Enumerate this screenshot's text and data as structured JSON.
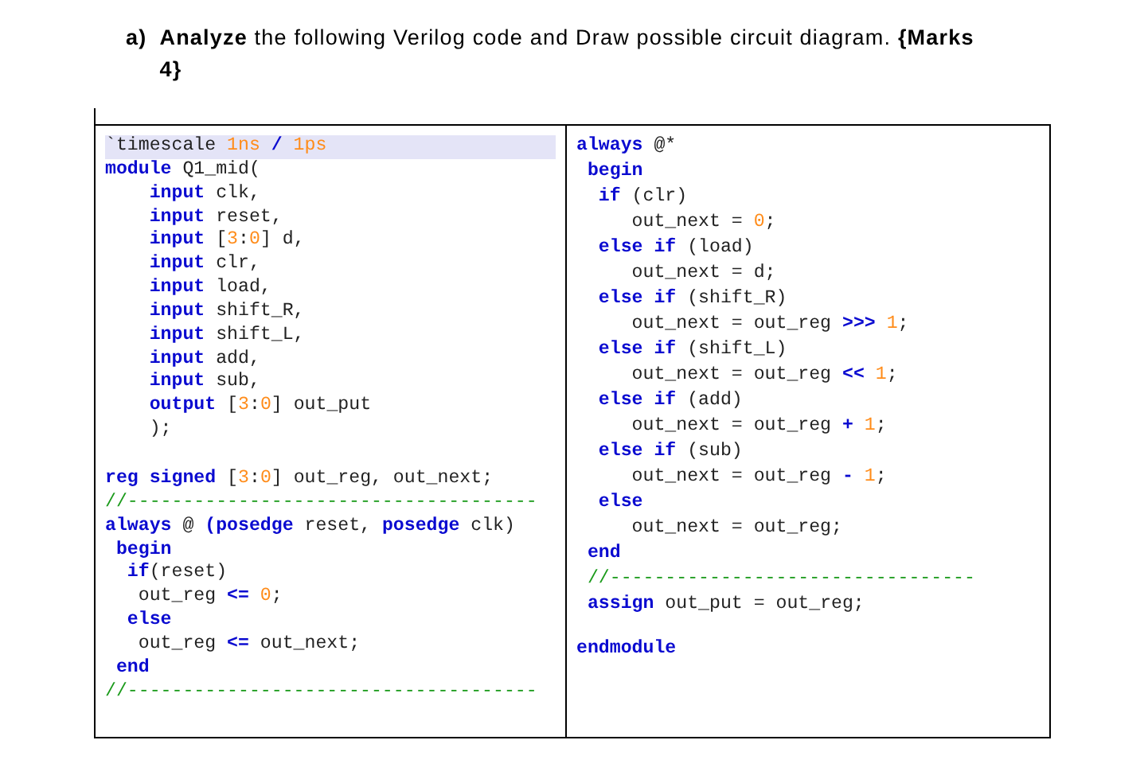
{
  "question": {
    "label": "a)",
    "text": "**Analyze** the following Verilog code and Draw possible circuit diagram. **{Marks 4}**"
  },
  "code_columns": [
    {
      "lines": [
        {
          "kind": "code",
          "highlighted": true,
          "tokens": [
            {
              "kind": "plain",
              "text": "`timescale "
            },
            {
              "kind": "num",
              "text": "1ns"
            },
            {
              "kind": "kw",
              "text": " / "
            },
            {
              "kind": "num",
              "text": "1ps"
            }
          ]
        },
        {
          "kind": "code",
          "highlighted": false,
          "tokens": [
            {
              "kind": "kw",
              "text": "module"
            },
            {
              "kind": "plain",
              "text": " Q1_mid("
            }
          ]
        },
        {
          "kind": "code",
          "highlighted": false,
          "tokens": [
            {
              "kind": "kw",
              "text": "    input"
            },
            {
              "kind": "plain",
              "text": " clk,"
            }
          ]
        },
        {
          "kind": "code",
          "highlighted": false,
          "tokens": [
            {
              "kind": "kw",
              "text": "    input"
            },
            {
              "kind": "plain",
              "text": " reset,"
            }
          ]
        },
        {
          "kind": "code",
          "highlighted": false,
          "tokens": [
            {
              "kind": "kw",
              "text": "    input"
            },
            {
              "kind": "plain",
              "text": " ["
            },
            {
              "kind": "num",
              "text": "3"
            },
            {
              "kind": "plain",
              "text": ":"
            },
            {
              "kind": "num",
              "text": "0"
            },
            {
              "kind": "plain",
              "text": "] d,"
            }
          ]
        },
        {
          "kind": "code",
          "highlighted": false,
          "tokens": [
            {
              "kind": "kw",
              "text": "    input"
            },
            {
              "kind": "plain",
              "text": " clr,"
            }
          ]
        },
        {
          "kind": "code",
          "highlighted": false,
          "tokens": [
            {
              "kind": "kw",
              "text": "    input"
            },
            {
              "kind": "plain",
              "text": " load,"
            }
          ]
        },
        {
          "kind": "code",
          "highlighted": false,
          "tokens": [
            {
              "kind": "kw",
              "text": "    input"
            },
            {
              "kind": "plain",
              "text": " shift_R,"
            }
          ]
        },
        {
          "kind": "code",
          "highlighted": false,
          "tokens": [
            {
              "kind": "kw",
              "text": "    input"
            },
            {
              "kind": "plain",
              "text": " shift_L,"
            }
          ]
        },
        {
          "kind": "code",
          "highlighted": false,
          "tokens": [
            {
              "kind": "kw",
              "text": "    input"
            },
            {
              "kind": "plain",
              "text": " add,"
            }
          ]
        },
        {
          "kind": "code",
          "highlighted": false,
          "tokens": [
            {
              "kind": "kw",
              "text": "    input"
            },
            {
              "kind": "plain",
              "text": " sub,"
            }
          ]
        },
        {
          "kind": "code",
          "highlighted": false,
          "tokens": [
            {
              "kind": "kw",
              "text": "    output"
            },
            {
              "kind": "plain",
              "text": " ["
            },
            {
              "kind": "num",
              "text": "3"
            },
            {
              "kind": "plain",
              "text": ":"
            },
            {
              "kind": "num",
              "text": "0"
            },
            {
              "kind": "plain",
              "text": "] out_put"
            }
          ]
        },
        {
          "kind": "code",
          "highlighted": false,
          "tokens": [
            {
              "kind": "plain",
              "text": "    );"
            }
          ]
        },
        {
          "kind": "blank",
          "highlighted": false
        },
        {
          "kind": "code",
          "highlighted": false,
          "tokens": [
            {
              "kind": "kw",
              "text": "reg signed"
            },
            {
              "kind": "plain",
              "text": " ["
            },
            {
              "kind": "num",
              "text": "3"
            },
            {
              "kind": "plain",
              "text": ":"
            },
            {
              "kind": "num",
              "text": "0"
            },
            {
              "kind": "plain",
              "text": "] out_reg, out_next;"
            }
          ]
        },
        {
          "kind": "code",
          "highlighted": false,
          "tokens": [
            {
              "kind": "comment",
              "text": "//-------------------------------------"
            }
          ]
        },
        {
          "kind": "code",
          "highlighted": false,
          "tokens": [
            {
              "kind": "kw",
              "text": "always"
            },
            {
              "kind": "plain",
              "text": " @ "
            },
            {
              "kind": "kw",
              "text": "(posedge"
            },
            {
              "kind": "plain",
              "text": " reset, "
            },
            {
              "kind": "kw",
              "text": "posedge"
            },
            {
              "kind": "plain",
              "text": " clk)"
            }
          ]
        },
        {
          "kind": "code",
          "highlighted": false,
          "tokens": [
            {
              "kind": "kw",
              "text": " begin"
            }
          ]
        },
        {
          "kind": "code",
          "highlighted": false,
          "tokens": [
            {
              "kind": "kw",
              "text": "  if"
            },
            {
              "kind": "plain",
              "text": "(reset)"
            }
          ]
        },
        {
          "kind": "code",
          "highlighted": false,
          "tokens": [
            {
              "kind": "plain",
              "text": "   out_reg "
            },
            {
              "kind": "kw",
              "text": "<= "
            },
            {
              "kind": "num",
              "text": "0"
            },
            {
              "kind": "plain",
              "text": ";"
            }
          ]
        },
        {
          "kind": "code",
          "highlighted": false,
          "tokens": [
            {
              "kind": "kw",
              "text": "  else"
            }
          ]
        },
        {
          "kind": "code",
          "highlighted": false,
          "tokens": [
            {
              "kind": "plain",
              "text": "   out_reg "
            },
            {
              "kind": "kw",
              "text": "<="
            },
            {
              "kind": "plain",
              "text": " out_next;"
            }
          ]
        },
        {
          "kind": "code",
          "highlighted": false,
          "tokens": [
            {
              "kind": "kw",
              "text": " end"
            }
          ]
        },
        {
          "kind": "code",
          "highlighted": false,
          "tokens": [
            {
              "kind": "comment",
              "text": "//-------------------------------------"
            }
          ]
        }
      ]
    },
    {
      "lines": [
        {
          "kind": "code",
          "highlighted": false,
          "tokens": [
            {
              "kind": "kw",
              "text": "always"
            },
            {
              "kind": "plain",
              "text": " @*"
            }
          ]
        },
        {
          "kind": "code",
          "highlighted": false,
          "tokens": [
            {
              "kind": "kw",
              "text": " begin"
            }
          ]
        },
        {
          "kind": "code",
          "highlighted": false,
          "tokens": [
            {
              "kind": "kw",
              "text": "  if"
            },
            {
              "kind": "plain",
              "text": " (clr)"
            }
          ]
        },
        {
          "kind": "code",
          "highlighted": false,
          "tokens": [
            {
              "kind": "plain",
              "text": "     out_next = "
            },
            {
              "kind": "num",
              "text": "0"
            },
            {
              "kind": "plain",
              "text": ";"
            }
          ]
        },
        {
          "kind": "code",
          "highlighted": false,
          "tokens": [
            {
              "kind": "kw",
              "text": "  else if"
            },
            {
              "kind": "plain",
              "text": " (load)"
            }
          ]
        },
        {
          "kind": "code",
          "highlighted": false,
          "tokens": [
            {
              "kind": "plain",
              "text": "     out_next = d;"
            }
          ]
        },
        {
          "kind": "code",
          "highlighted": false,
          "tokens": [
            {
              "kind": "kw",
              "text": "  else if"
            },
            {
              "kind": "plain",
              "text": " (shift_R)"
            }
          ]
        },
        {
          "kind": "code",
          "highlighted": false,
          "tokens": [
            {
              "kind": "plain",
              "text": "     out_next = out_reg "
            },
            {
              "kind": "kw",
              "text": ">>> "
            },
            {
              "kind": "num",
              "text": "1"
            },
            {
              "kind": "plain",
              "text": ";"
            }
          ]
        },
        {
          "kind": "code",
          "highlighted": false,
          "tokens": [
            {
              "kind": "kw",
              "text": "  else if"
            },
            {
              "kind": "plain",
              "text": " (shift_L)"
            }
          ]
        },
        {
          "kind": "code",
          "highlighted": false,
          "tokens": [
            {
              "kind": "plain",
              "text": "     out_next = out_reg "
            },
            {
              "kind": "kw",
              "text": "<< "
            },
            {
              "kind": "num",
              "text": "1"
            },
            {
              "kind": "plain",
              "text": ";"
            }
          ]
        },
        {
          "kind": "code",
          "highlighted": false,
          "tokens": [
            {
              "kind": "kw",
              "text": "  else if"
            },
            {
              "kind": "plain",
              "text": " (add)"
            }
          ]
        },
        {
          "kind": "code",
          "highlighted": false,
          "tokens": [
            {
              "kind": "plain",
              "text": "     out_next = out_reg "
            },
            {
              "kind": "kw",
              "text": "+ "
            },
            {
              "kind": "num",
              "text": "1"
            },
            {
              "kind": "plain",
              "text": ";"
            }
          ]
        },
        {
          "kind": "code",
          "highlighted": false,
          "tokens": [
            {
              "kind": "kw",
              "text": "  else if"
            },
            {
              "kind": "plain",
              "text": " (sub)"
            }
          ]
        },
        {
          "kind": "code",
          "highlighted": false,
          "tokens": [
            {
              "kind": "plain",
              "text": "     out_next = out_reg "
            },
            {
              "kind": "kw",
              "text": "- "
            },
            {
              "kind": "num",
              "text": "1"
            },
            {
              "kind": "plain",
              "text": ";"
            }
          ]
        },
        {
          "kind": "code",
          "highlighted": false,
          "tokens": [
            {
              "kind": "kw",
              "text": "  else"
            }
          ]
        },
        {
          "kind": "code",
          "highlighted": false,
          "tokens": [
            {
              "kind": "plain",
              "text": "     out_next = out_reg;"
            }
          ]
        },
        {
          "kind": "code",
          "highlighted": false,
          "tokens": [
            {
              "kind": "kw",
              "text": " end"
            }
          ]
        },
        {
          "kind": "code",
          "highlighted": false,
          "tokens": [
            {
              "kind": "comment",
              "text": " //---------------------------------"
            }
          ]
        },
        {
          "kind": "code",
          "highlighted": false,
          "tokens": [
            {
              "kind": "kw",
              "text": " assign"
            },
            {
              "kind": "plain",
              "text": " out_put = out_reg;"
            }
          ]
        },
        {
          "kind": "blank",
          "highlighted": false
        },
        {
          "kind": "code",
          "highlighted": false,
          "tokens": [
            {
              "kind": "kw",
              "text": "endmodule"
            }
          ]
        }
      ]
    }
  ]
}
